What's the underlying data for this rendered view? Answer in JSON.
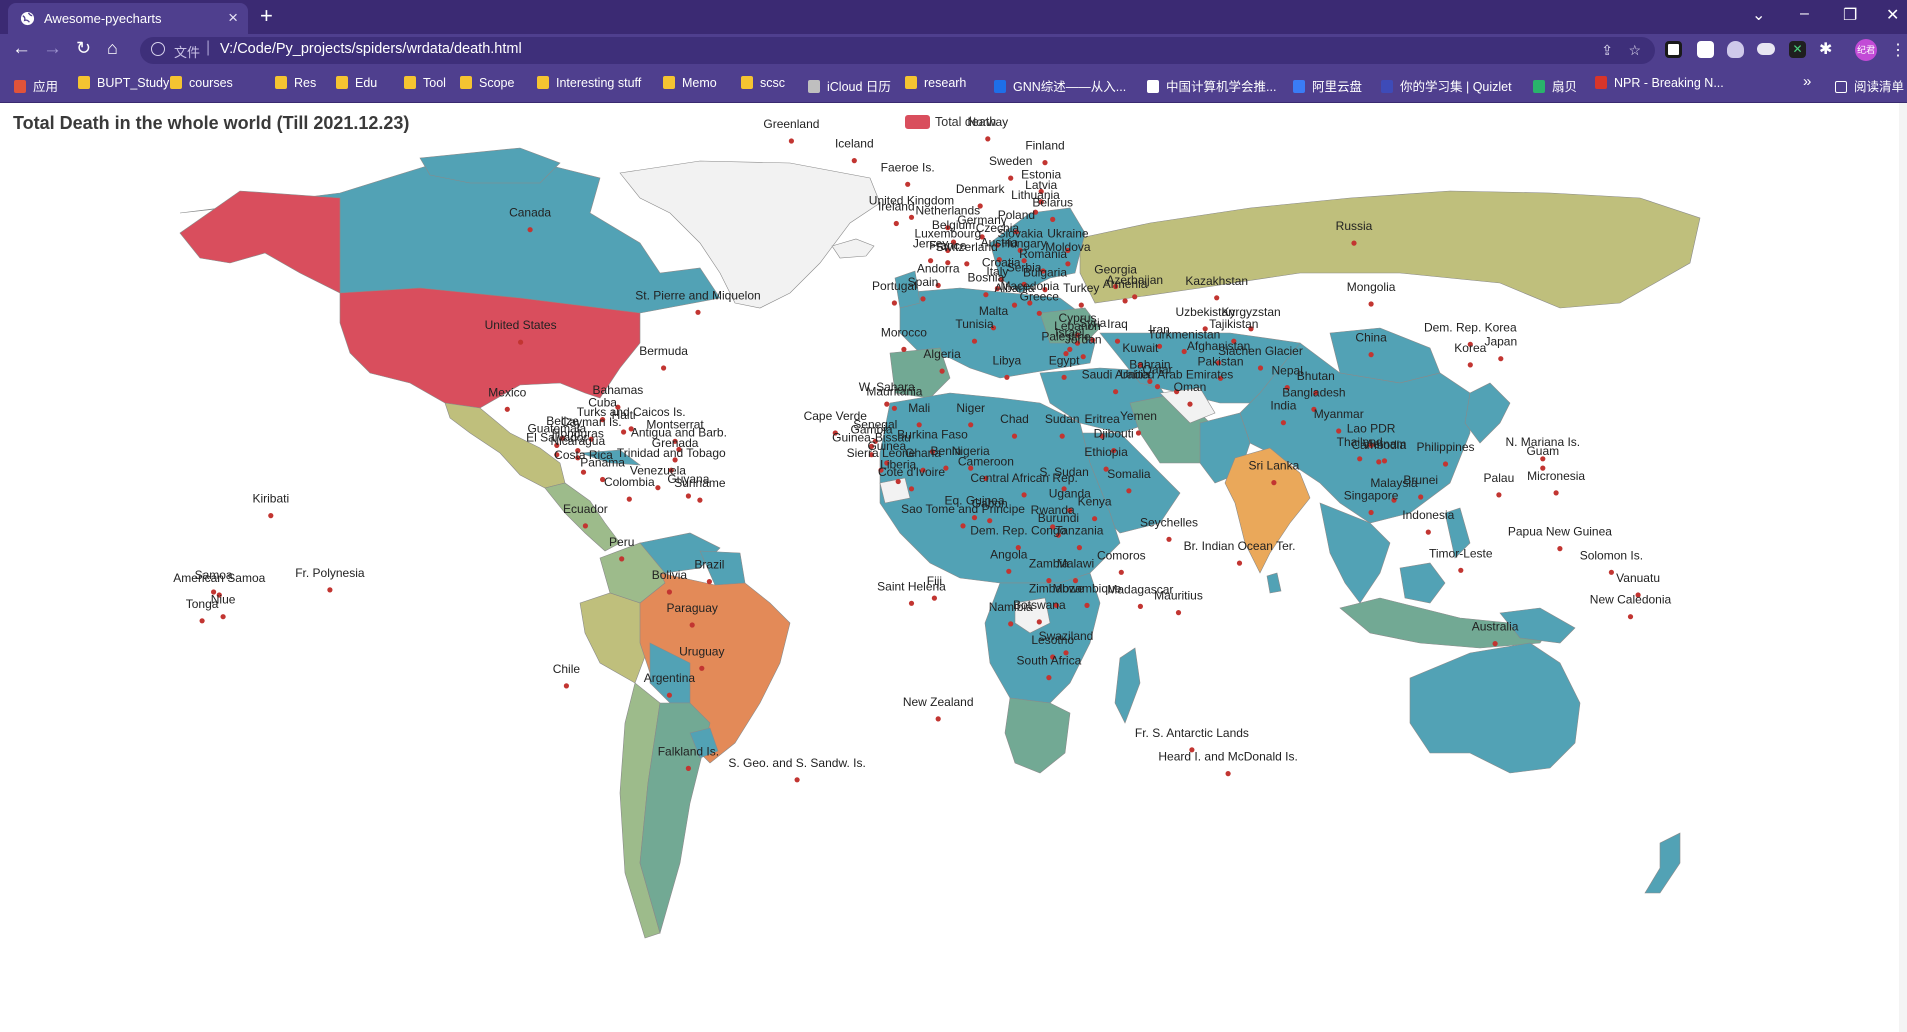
{
  "browser": {
    "tab_title": "Awesome-pyecharts",
    "new_tab": "+",
    "url_prefix": "文件",
    "url": "V:/Code/Py_projects/spiders/wrdata/death.html",
    "bookmarks": [
      {
        "label": "应用",
        "color": "#e0533a"
      },
      {
        "label": "BUPT_Study",
        "color": "#f5c431"
      },
      {
        "label": "courses",
        "color": "#f5c431"
      },
      {
        "label": "Res",
        "color": "#f5c431"
      },
      {
        "label": "Edu",
        "color": "#f5c431"
      },
      {
        "label": "Tool",
        "color": "#f5c431"
      },
      {
        "label": "Scope",
        "color": "#f5c431"
      },
      {
        "label": "Interesting stuff",
        "color": "#f5c431"
      },
      {
        "label": "Memo",
        "color": "#f5c431"
      },
      {
        "label": "scsc",
        "color": "#f5c431"
      },
      {
        "label": "iCloud 日历",
        "color": "#bfbfbf"
      },
      {
        "label": "researh",
        "color": "#f5c431"
      },
      {
        "label": "GNN综述——从入...",
        "color": "#1e6fe8"
      },
      {
        "label": "中国计算机学会推...",
        "color": "#ffffff"
      },
      {
        "label": "阿里云盘",
        "color": "#3a7cf5"
      },
      {
        "label": "你的学习集 | Quizlet",
        "color": "#3e4bb8"
      },
      {
        "label": "扇贝",
        "color": "#29b36b"
      },
      {
        "label": "NPR - Breaking N...",
        "color": "#d8352a"
      }
    ],
    "bookmarks_overflow": "»",
    "reading_list": "阅读清单",
    "avatar_text": "纪君"
  },
  "page": {
    "title": "Total Death in the whole world (Till 2021.12.23)",
    "legend_label": "Total death",
    "legend_color": "#d94e5d",
    "colors": {
      "red": "#d94e5d",
      "orange": "#e38a58",
      "amber": "#eaa85a",
      "khaki": "#bfbf7c",
      "sage": "#9dbb8b",
      "teal": "#72a994",
      "blue": "#52a2b5",
      "none": "#f2f2f2",
      "dot": "#c23531"
    }
  },
  "chart_data": {
    "type": "map",
    "title": "Total Death in the whole world (Till 2021.12.23)",
    "series": [
      {
        "name": "Total death"
      }
    ],
    "legend": "top",
    "fill_classes": {
      "red": [
        "United States",
        "Alaska"
      ],
      "orange": [
        "Brazil"
      ],
      "amber": [
        "India"
      ],
      "khaki": [
        "Russia",
        "Mexico",
        "Peru"
      ],
      "sage": [
        "Colombia",
        "Argentina",
        "Chile"
      ],
      "teal": [
        "Ukraine",
        "Iran",
        "Poland",
        "Italy",
        "South Africa"
      ],
      "blue": [
        "Canada",
        "China",
        "Australia",
        "Kazakhstan",
        "Mongolia"
      ],
      "none": [
        "Greenland",
        "Iceland",
        "Western Sahara"
      ]
    },
    "labels": [
      {
        "name": "Greenland",
        "x": 0.415,
        "y": 0.124
      },
      {
        "name": "Iceland",
        "x": 0.448,
        "y": 0.143
      },
      {
        "name": "Norway",
        "x": 0.518,
        "y": 0.122
      },
      {
        "name": "Finland",
        "x": 0.548,
        "y": 0.145
      },
      {
        "name": "Sweden",
        "x": 0.53,
        "y": 0.16
      },
      {
        "name": "Estonia",
        "x": 0.546,
        "y": 0.173
      },
      {
        "name": "Latvia",
        "x": 0.546,
        "y": 0.183
      },
      {
        "name": "Lithuania",
        "x": 0.543,
        "y": 0.193
      },
      {
        "name": "Belarus",
        "x": 0.552,
        "y": 0.2
      },
      {
        "name": "Denmark",
        "x": 0.514,
        "y": 0.187
      },
      {
        "name": "Faeroe Is.",
        "x": 0.476,
        "y": 0.166
      },
      {
        "name": "United Kingdom",
        "x": 0.478,
        "y": 0.198
      },
      {
        "name": "Ireland",
        "x": 0.47,
        "y": 0.204
      },
      {
        "name": "Netherlands",
        "x": 0.497,
        "y": 0.208
      },
      {
        "name": "Poland",
        "x": 0.533,
        "y": 0.212
      },
      {
        "name": "Belgium",
        "x": 0.5,
        "y": 0.222
      },
      {
        "name": "Germany",
        "x": 0.515,
        "y": 0.217
      },
      {
        "name": "Luxembourg",
        "x": 0.497,
        "y": 0.23
      },
      {
        "name": "Slovakia",
        "x": 0.535,
        "y": 0.23
      },
      {
        "name": "Ukraine",
        "x": 0.56,
        "y": 0.23
      },
      {
        "name": "Czechia",
        "x": 0.523,
        "y": 0.225
      },
      {
        "name": "Jersey",
        "x": 0.488,
        "y": 0.24
      },
      {
        "name": "France",
        "x": 0.497,
        "y": 0.242
      },
      {
        "name": "Switzerland",
        "x": 0.507,
        "y": 0.243
      },
      {
        "name": "Austria",
        "x": 0.524,
        "y": 0.239
      },
      {
        "name": "Hungary",
        "x": 0.537,
        "y": 0.24
      },
      {
        "name": "Moldova",
        "x": 0.56,
        "y": 0.243
      },
      {
        "name": "Romania",
        "x": 0.547,
        "y": 0.25
      },
      {
        "name": "Croatia",
        "x": 0.525,
        "y": 0.258
      },
      {
        "name": "Serbia",
        "x": 0.537,
        "y": 0.263
      },
      {
        "name": "Bulgaria",
        "x": 0.548,
        "y": 0.268
      },
      {
        "name": "Bosnia",
        "x": 0.517,
        "y": 0.273
      },
      {
        "name": "Andorra",
        "x": 0.492,
        "y": 0.264
      },
      {
        "name": "Spain",
        "x": 0.484,
        "y": 0.277
      },
      {
        "name": "Portugal",
        "x": 0.469,
        "y": 0.281
      },
      {
        "name": "Italy",
        "x": 0.523,
        "y": 0.267
      },
      {
        "name": "Macedonia",
        "x": 0.54,
        "y": 0.281
      },
      {
        "name": "Greece",
        "x": 0.545,
        "y": 0.291
      },
      {
        "name": "Albania",
        "x": 0.532,
        "y": 0.283
      },
      {
        "name": "Turkey",
        "x": 0.567,
        "y": 0.283
      },
      {
        "name": "Georgia",
        "x": 0.585,
        "y": 0.265
      },
      {
        "name": "Azerbaijan",
        "x": 0.595,
        "y": 0.275
      },
      {
        "name": "Armenia",
        "x": 0.59,
        "y": 0.279
      },
      {
        "name": "Malta",
        "x": 0.521,
        "y": 0.305
      },
      {
        "name": "Tunisia",
        "x": 0.511,
        "y": 0.318
      },
      {
        "name": "Cyprus",
        "x": 0.565,
        "y": 0.312
      },
      {
        "name": "Syria",
        "x": 0.573,
        "y": 0.317
      },
      {
        "name": "Lebanon",
        "x": 0.565,
        "y": 0.32
      },
      {
        "name": "Iraq",
        "x": 0.586,
        "y": 0.318
      },
      {
        "name": "Israel",
        "x": 0.561,
        "y": 0.326
      },
      {
        "name": "Palestine",
        "x": 0.559,
        "y": 0.33
      },
      {
        "name": "Jordan",
        "x": 0.568,
        "y": 0.333
      },
      {
        "name": "Iran",
        "x": 0.608,
        "y": 0.323
      },
      {
        "name": "Kuwait",
        "x": 0.598,
        "y": 0.341
      },
      {
        "name": "Morocco",
        "x": 0.474,
        "y": 0.326
      },
      {
        "name": "Algeria",
        "x": 0.494,
        "y": 0.347
      },
      {
        "name": "Libya",
        "x": 0.528,
        "y": 0.353
      },
      {
        "name": "Egypt",
        "x": 0.558,
        "y": 0.353
      },
      {
        "name": "Bahrain",
        "x": 0.603,
        "y": 0.357
      },
      {
        "name": "Qatar",
        "x": 0.607,
        "y": 0.362
      },
      {
        "name": "Saudi Arabia",
        "x": 0.585,
        "y": 0.367
      },
      {
        "name": "United Arab Emirates",
        "x": 0.617,
        "y": 0.367
      },
      {
        "name": "Oman",
        "x": 0.624,
        "y": 0.379
      },
      {
        "name": "W. Sahara",
        "x": 0.465,
        "y": 0.379
      },
      {
        "name": "Mauritania",
        "x": 0.469,
        "y": 0.383
      },
      {
        "name": "Mali",
        "x": 0.482,
        "y": 0.399
      },
      {
        "name": "Niger",
        "x": 0.509,
        "y": 0.399
      },
      {
        "name": "Chad",
        "x": 0.532,
        "y": 0.41
      },
      {
        "name": "Sudan",
        "x": 0.557,
        "y": 0.41
      },
      {
        "name": "Eritrea",
        "x": 0.578,
        "y": 0.41
      },
      {
        "name": "Yemen",
        "x": 0.597,
        "y": 0.407
      },
      {
        "name": "Djibouti",
        "x": 0.584,
        "y": 0.424
      },
      {
        "name": "Senegal",
        "x": 0.459,
        "y": 0.415
      },
      {
        "name": "Gambia",
        "x": 0.457,
        "y": 0.42
      },
      {
        "name": "Guinea-Bissau",
        "x": 0.457,
        "y": 0.428
      },
      {
        "name": "Guinea",
        "x": 0.465,
        "y": 0.436
      },
      {
        "name": "Burkina Faso",
        "x": 0.489,
        "y": 0.425
      },
      {
        "name": "Nigeria",
        "x": 0.509,
        "y": 0.441
      },
      {
        "name": "Ethiopia",
        "x": 0.58,
        "y": 0.442
      },
      {
        "name": "Sierra Leone",
        "x": 0.462,
        "y": 0.443
      },
      {
        "name": "Ghana",
        "x": 0.484,
        "y": 0.443
      },
      {
        "name": "Benin",
        "x": 0.496,
        "y": 0.441
      },
      {
        "name": "Liberia",
        "x": 0.471,
        "y": 0.454
      },
      {
        "name": "Cote d'Ivoire",
        "x": 0.478,
        "y": 0.461
      },
      {
        "name": "Cameroon",
        "x": 0.517,
        "y": 0.451
      },
      {
        "name": "Central African Rep.",
        "x": 0.537,
        "y": 0.467
      },
      {
        "name": "S. Sudan",
        "x": 0.558,
        "y": 0.461
      },
      {
        "name": "Somalia",
        "x": 0.592,
        "y": 0.463
      },
      {
        "name": "Cape Verde",
        "x": 0.438,
        "y": 0.407
      },
      {
        "name": "Uganda",
        "x": 0.561,
        "y": 0.482
      },
      {
        "name": "Kenya",
        "x": 0.574,
        "y": 0.49
      },
      {
        "name": "Eq. Guinea",
        "x": 0.511,
        "y": 0.489
      },
      {
        "name": "Gabon",
        "x": 0.519,
        "y": 0.492
      },
      {
        "name": "Sao Tome and Principe",
        "x": 0.505,
        "y": 0.497
      },
      {
        "name": "Rwanda",
        "x": 0.552,
        "y": 0.498
      },
      {
        "name": "Burundi",
        "x": 0.555,
        "y": 0.506
      },
      {
        "name": "Dem. Rep. Congo",
        "x": 0.534,
        "y": 0.518
      },
      {
        "name": "Tanzania",
        "x": 0.566,
        "y": 0.518
      },
      {
        "name": "Seychelles",
        "x": 0.613,
        "y": 0.51
      },
      {
        "name": "Angola",
        "x": 0.529,
        "y": 0.541
      },
      {
        "name": "Comoros",
        "x": 0.588,
        "y": 0.542
      },
      {
        "name": "Zambia",
        "x": 0.55,
        "y": 0.55
      },
      {
        "name": "Malawi",
        "x": 0.564,
        "y": 0.55
      },
      {
        "name": "Zimbabwe",
        "x": 0.554,
        "y": 0.574
      },
      {
        "name": "Mozambique",
        "x": 0.57,
        "y": 0.574
      },
      {
        "name": "Madagascar",
        "x": 0.598,
        "y": 0.575
      },
      {
        "name": "Mauritius",
        "x": 0.618,
        "y": 0.581
      },
      {
        "name": "Namibia",
        "x": 0.53,
        "y": 0.592
      },
      {
        "name": "Botswana",
        "x": 0.545,
        "y": 0.59
      },
      {
        "name": "Swaziland",
        "x": 0.559,
        "y": 0.62
      },
      {
        "name": "Lesotho",
        "x": 0.552,
        "y": 0.624
      },
      {
        "name": "South Africa",
        "x": 0.55,
        "y": 0.644
      },
      {
        "name": "Saint Helena",
        "x": 0.478,
        "y": 0.572
      },
      {
        "name": "Fiji",
        "x": 0.49,
        "y": 0.567
      },
      {
        "name": "Russia",
        "x": 0.71,
        "y": 0.223
      },
      {
        "name": "Kazakhstan",
        "x": 0.638,
        "y": 0.276
      },
      {
        "name": "Mongolia",
        "x": 0.719,
        "y": 0.282
      },
      {
        "name": "Uzbekistan",
        "x": 0.632,
        "y": 0.306
      },
      {
        "name": "Kyrgyzstan",
        "x": 0.656,
        "y": 0.306
      },
      {
        "name": "Tajikistan",
        "x": 0.647,
        "y": 0.318
      },
      {
        "name": "Turkmenistan",
        "x": 0.621,
        "y": 0.328
      },
      {
        "name": "Afghanistan",
        "x": 0.639,
        "y": 0.339
      },
      {
        "name": "Siachen Glacier",
        "x": 0.661,
        "y": 0.344
      },
      {
        "name": "Pakistan",
        "x": 0.64,
        "y": 0.354
      },
      {
        "name": "China",
        "x": 0.719,
        "y": 0.331
      },
      {
        "name": "Dem. Rep. Korea",
        "x": 0.771,
        "y": 0.321
      },
      {
        "name": "Korea",
        "x": 0.771,
        "y": 0.341
      },
      {
        "name": "Japan",
        "x": 0.787,
        "y": 0.335
      },
      {
        "name": "Nepal",
        "x": 0.675,
        "y": 0.363
      },
      {
        "name": "Bhutan",
        "x": 0.69,
        "y": 0.368
      },
      {
        "name": "Bangladesh",
        "x": 0.689,
        "y": 0.384
      },
      {
        "name": "India",
        "x": 0.673,
        "y": 0.397
      },
      {
        "name": "Myanmar",
        "x": 0.702,
        "y": 0.405
      },
      {
        "name": "Lao PDR",
        "x": 0.719,
        "y": 0.419
      },
      {
        "name": "Thailand",
        "x": 0.713,
        "y": 0.432
      },
      {
        "name": "Vietnam",
        "x": 0.726,
        "y": 0.434
      },
      {
        "name": "Cambodia",
        "x": 0.723,
        "y": 0.435
      },
      {
        "name": "Philippines",
        "x": 0.758,
        "y": 0.437
      },
      {
        "name": "Sri Lanka",
        "x": 0.668,
        "y": 0.455
      },
      {
        "name": "Malaysia",
        "x": 0.731,
        "y": 0.472
      },
      {
        "name": "Brunei",
        "x": 0.745,
        "y": 0.469
      },
      {
        "name": "Singapore",
        "x": 0.719,
        "y": 0.484
      },
      {
        "name": "Indonesia",
        "x": 0.749,
        "y": 0.503
      },
      {
        "name": "Papua New Guinea",
        "x": 0.818,
        "y": 0.519
      },
      {
        "name": "Timor-Leste",
        "x": 0.766,
        "y": 0.54
      },
      {
        "name": "Solomon Is.",
        "x": 0.845,
        "y": 0.542
      },
      {
        "name": "Vanuatu",
        "x": 0.859,
        "y": 0.564
      },
      {
        "name": "New Caledonia",
        "x": 0.855,
        "y": 0.585
      },
      {
        "name": "N. Mariana Is.",
        "x": 0.809,
        "y": 0.432
      },
      {
        "name": "Guam",
        "x": 0.809,
        "y": 0.441
      },
      {
        "name": "Palau",
        "x": 0.786,
        "y": 0.467
      },
      {
        "name": "Micronesia",
        "x": 0.816,
        "y": 0.465
      },
      {
        "name": "Australia",
        "x": 0.784,
        "y": 0.611
      },
      {
        "name": "New Zealand",
        "x": 0.492,
        "y": 0.684
      },
      {
        "name": "Fr. S. Antarctic Lands",
        "x": 0.625,
        "y": 0.714
      },
      {
        "name": "Heard I. and McDonald Is.",
        "x": 0.644,
        "y": 0.737
      },
      {
        "name": "Br. Indian Ocean Ter.",
        "x": 0.65,
        "y": 0.533
      },
      {
        "name": "Canada",
        "x": 0.278,
        "y": 0.21
      },
      {
        "name": "United States",
        "x": 0.273,
        "y": 0.319
      },
      {
        "name": "St. Pierre and Miquelon",
        "x": 0.366,
        "y": 0.29
      },
      {
        "name": "Bermuda",
        "x": 0.348,
        "y": 0.344
      },
      {
        "name": "Mexico",
        "x": 0.266,
        "y": 0.384
      },
      {
        "name": "Bahamas",
        "x": 0.324,
        "y": 0.382
      },
      {
        "name": "Cuba",
        "x": 0.316,
        "y": 0.394
      },
      {
        "name": "Turks and Caicos Is.",
        "x": 0.331,
        "y": 0.403
      },
      {
        "name": "Haiti",
        "x": 0.327,
        "y": 0.406
      },
      {
        "name": "Belize",
        "x": 0.295,
        "y": 0.412
      },
      {
        "name": "Cayman Is.",
        "x": 0.31,
        "y": 0.413
      },
      {
        "name": "Montserrat",
        "x": 0.354,
        "y": 0.415
      },
      {
        "name": "Guatemala",
        "x": 0.292,
        "y": 0.419
      },
      {
        "name": "Antigua and Barb.",
        "x": 0.356,
        "y": 0.423
      },
      {
        "name": "Honduras",
        "x": 0.303,
        "y": 0.424
      },
      {
        "name": "El Salvador",
        "x": 0.292,
        "y": 0.428
      },
      {
        "name": "Nicaragua",
        "x": 0.303,
        "y": 0.431
      },
      {
        "name": "Grenada",
        "x": 0.354,
        "y": 0.433
      },
      {
        "name": "Trinidad and Tobago",
        "x": 0.352,
        "y": 0.443
      },
      {
        "name": "Costa Rica",
        "x": 0.306,
        "y": 0.445
      },
      {
        "name": "Panama",
        "x": 0.316,
        "y": 0.452
      },
      {
        "name": "Venezuela",
        "x": 0.345,
        "y": 0.46
      },
      {
        "name": "Guyana",
        "x": 0.361,
        "y": 0.468
      },
      {
        "name": "Suriname",
        "x": 0.367,
        "y": 0.472
      },
      {
        "name": "Colombia",
        "x": 0.33,
        "y": 0.471
      },
      {
        "name": "Ecuador",
        "x": 0.307,
        "y": 0.497
      },
      {
        "name": "Peru",
        "x": 0.326,
        "y": 0.529
      },
      {
        "name": "Brazil",
        "x": 0.372,
        "y": 0.551
      },
      {
        "name": "Bolivia",
        "x": 0.351,
        "y": 0.561
      },
      {
        "name": "Paraguay",
        "x": 0.363,
        "y": 0.593
      },
      {
        "name": "Uruguay",
        "x": 0.368,
        "y": 0.635
      },
      {
        "name": "Argentina",
        "x": 0.351,
        "y": 0.661
      },
      {
        "name": "Chile",
        "x": 0.297,
        "y": 0.652
      },
      {
        "name": "Falkland Is.",
        "x": 0.361,
        "y": 0.732
      },
      {
        "name": "S. Geo. and S. Sandw. Is.",
        "x": 0.418,
        "y": 0.743
      },
      {
        "name": "Kiribati",
        "x": 0.142,
        "y": 0.487
      },
      {
        "name": "American Samoa",
        "x": 0.115,
        "y": 0.564
      },
      {
        "name": "Samoa",
        "x": 0.112,
        "y": 0.561
      },
      {
        "name": "Fr. Polynesia",
        "x": 0.173,
        "y": 0.559
      },
      {
        "name": "Niue",
        "x": 0.117,
        "y": 0.585
      },
      {
        "name": "Tonga",
        "x": 0.106,
        "y": 0.589
      }
    ]
  }
}
